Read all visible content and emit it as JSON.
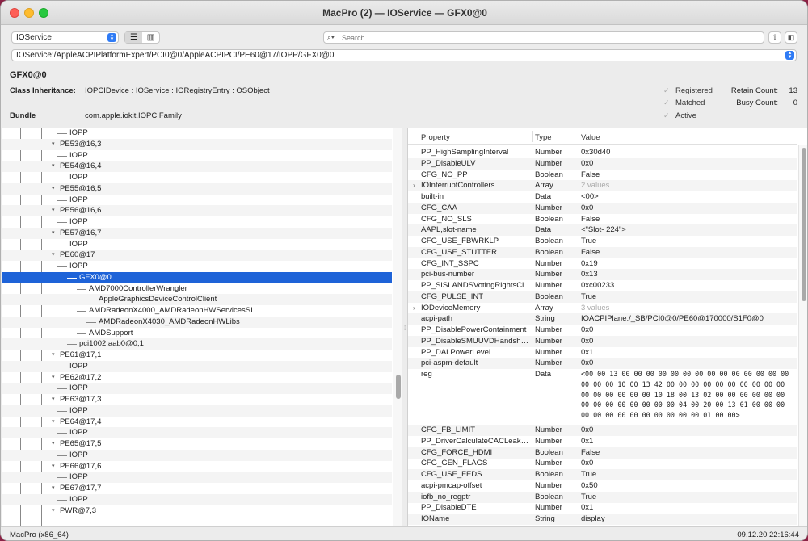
{
  "window": {
    "title": "MacPro (2) — IOService — GFX0@0"
  },
  "toolbar": {
    "plane": "IOService",
    "search_placeholder": "Search",
    "path": "IOService:/AppleACPIPlatformExpert/PCI0@0/AppleACPIPCI/PE60@17/IOPP/GFX0@0"
  },
  "info": {
    "object_name": "GFX0@0",
    "class_inheritance_label": "Class Inheritance:",
    "class_inheritance": "IOPCIDevice : IOService : IORegistryEntry : OSObject",
    "bundle_label": "Bundle",
    "bundle": "com.apple.iokit.IOPCIFamily",
    "registered_label": "Registered",
    "matched_label": "Matched",
    "active_label": "Active",
    "retain_count_label": "Retain Count:",
    "retain_count": "13",
    "busy_count_label": "Busy Count:",
    "busy_count": "0"
  },
  "tree": [
    {
      "label": "IOPP",
      "level": 1,
      "selected": false
    },
    {
      "label": "PE53@16,3",
      "level": 0,
      "selected": false
    },
    {
      "label": "IOPP",
      "level": 1,
      "selected": false
    },
    {
      "label": "PE54@16,4",
      "level": 0,
      "selected": false
    },
    {
      "label": "IOPP",
      "level": 1,
      "selected": false
    },
    {
      "label": "PE55@16,5",
      "level": 0,
      "selected": false
    },
    {
      "label": "IOPP",
      "level": 1,
      "selected": false
    },
    {
      "label": "PE56@16,6",
      "level": 0,
      "selected": false
    },
    {
      "label": "IOPP",
      "level": 1,
      "selected": false
    },
    {
      "label": "PE57@16,7",
      "level": 0,
      "selected": false
    },
    {
      "label": "IOPP",
      "level": 1,
      "selected": false
    },
    {
      "label": "PE60@17",
      "level": 0,
      "selected": false
    },
    {
      "label": "IOPP",
      "level": 1,
      "selected": false
    },
    {
      "label": "GFX0@0",
      "level": 2,
      "selected": true
    },
    {
      "label": "AMD7000ControllerWrangler",
      "level": 3,
      "selected": false
    },
    {
      "label": "AppleGraphicsDeviceControlClient",
      "level": 4,
      "selected": false
    },
    {
      "label": "AMDRadeonX4000_AMDRadeonHWServicesSI",
      "level": 3,
      "selected": false
    },
    {
      "label": "AMDRadeonX4030_AMDRadeonHWLibs",
      "level": 4,
      "selected": false
    },
    {
      "label": "AMDSupport",
      "level": 3,
      "selected": false
    },
    {
      "label": "pci1002,aab0@0,1",
      "level": 2,
      "selected": false
    },
    {
      "label": "PE61@17,1",
      "level": 0,
      "selected": false
    },
    {
      "label": "IOPP",
      "level": 1,
      "selected": false
    },
    {
      "label": "PE62@17,2",
      "level": 0,
      "selected": false
    },
    {
      "label": "IOPP",
      "level": 1,
      "selected": false
    },
    {
      "label": "PE63@17,3",
      "level": 0,
      "selected": false
    },
    {
      "label": "IOPP",
      "level": 1,
      "selected": false
    },
    {
      "label": "PE64@17,4",
      "level": 0,
      "selected": false
    },
    {
      "label": "IOPP",
      "level": 1,
      "selected": false
    },
    {
      "label": "PE65@17,5",
      "level": 0,
      "selected": false
    },
    {
      "label": "IOPP",
      "level": 1,
      "selected": false
    },
    {
      "label": "PE66@17,6",
      "level": 0,
      "selected": false
    },
    {
      "label": "IOPP",
      "level": 1,
      "selected": false
    },
    {
      "label": "PE67@17,7",
      "level": 0,
      "selected": false
    },
    {
      "label": "IOPP",
      "level": 1,
      "selected": false
    },
    {
      "label": "PWR@7,3",
      "level": 0,
      "selected": false
    }
  ],
  "properties": {
    "headers": [
      "Property",
      "Type",
      "Value"
    ],
    "rows": [
      {
        "name": "PP_HighSamplingInterval",
        "type": "Number",
        "value": "0x30d40"
      },
      {
        "name": "PP_DisableULV",
        "type": "Number",
        "value": "0x0"
      },
      {
        "name": "CFG_NO_PP",
        "type": "Boolean",
        "value": "False"
      },
      {
        "name": "IOInterruptControllers",
        "type": "Array",
        "value": "2 values",
        "expandable": true
      },
      {
        "name": "built-in",
        "type": "Data",
        "value": "<00>"
      },
      {
        "name": "CFG_CAA",
        "type": "Number",
        "value": "0x0"
      },
      {
        "name": "CFG_NO_SLS",
        "type": "Boolean",
        "value": "False"
      },
      {
        "name": "AAPL,slot-name",
        "type": "Data",
        "value": "<\"Slot- 224\">"
      },
      {
        "name": "CFG_USE_FBWRKLP",
        "type": "Boolean",
        "value": "True"
      },
      {
        "name": "CFG_USE_STUTTER",
        "type": "Boolean",
        "value": "False"
      },
      {
        "name": "CFG_INT_SSPC",
        "type": "Number",
        "value": "0x19"
      },
      {
        "name": "pci-bus-number",
        "type": "Number",
        "value": "0x13"
      },
      {
        "name": "PP_SISLANDSVotingRightsClients",
        "type": "Number",
        "value": "0xc00233"
      },
      {
        "name": "CFG_PULSE_INT",
        "type": "Boolean",
        "value": "True"
      },
      {
        "name": "IODeviceMemory",
        "type": "Array",
        "value": "3 values",
        "expandable": true
      },
      {
        "name": "acpi-path",
        "type": "String",
        "value": "IOACPIPlane:/_SB/PCI0@0/PE60@170000/S1F0@0"
      },
      {
        "name": "PP_DisablePowerContainment",
        "type": "Number",
        "value": "0x0"
      },
      {
        "name": "PP_DisableSMUUVDHandshake",
        "type": "Number",
        "value": "0x0"
      },
      {
        "name": "PP_DALPowerLevel",
        "type": "Number",
        "value": "0x1"
      },
      {
        "name": "pci-aspm-default",
        "type": "Number",
        "value": "0x0"
      },
      {
        "name": "reg",
        "type": "Data",
        "value": "<00 00 13 00 00 00 00 00 00 00 00 00 00 00 00 00 00 00 00 00 10 00 13 42 00 00 00 00 00 00 00 00 00 00 00 00 00 00 00 00 10 18 00 13 02 00 00 00 00 00 00 00 00 00 00 00 00 00 00 04 00 20 00 13 01 00 00 00 00 00 00 00 00 00 00 00 00 00 01 00 00>",
        "rows": 5
      },
      {
        "name": "CFG_FB_LIMIT",
        "type": "Number",
        "value": "0x0"
      },
      {
        "name": "PP_DriverCalculateCACLeakage",
        "type": "Number",
        "value": "0x1"
      },
      {
        "name": "CFG_FORCE_HDMI",
        "type": "Boolean",
        "value": "False"
      },
      {
        "name": "CFG_GEN_FLAGS",
        "type": "Number",
        "value": "0x0"
      },
      {
        "name": "CFG_USE_FEDS",
        "type": "Boolean",
        "value": "True"
      },
      {
        "name": "acpi-pmcap-offset",
        "type": "Number",
        "value": "0x50"
      },
      {
        "name": "iofb_no_regptr",
        "type": "Boolean",
        "value": "True"
      },
      {
        "name": "PP_DisableDTE",
        "type": "Number",
        "value": "0x1"
      },
      {
        "name": "IOName",
        "type": "String",
        "value": "display"
      }
    ]
  },
  "status": {
    "left": "MacPro (x86_64)",
    "right": "09.12.20  22:16:44"
  }
}
